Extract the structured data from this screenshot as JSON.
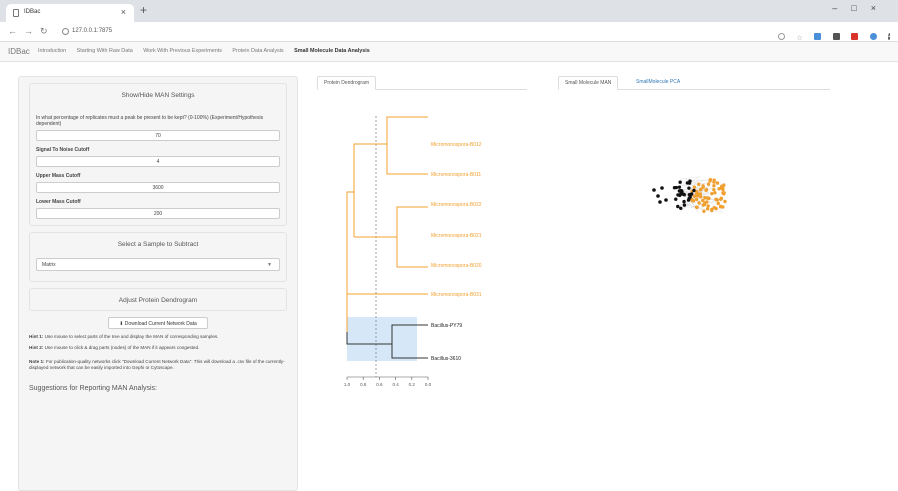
{
  "browser": {
    "tab_title": "IDBac",
    "url": "127.0.0.1:7875"
  },
  "app": {
    "brand": "IDBac",
    "nav": [
      {
        "label": "Introduction"
      },
      {
        "label": "Starting With Raw Data"
      },
      {
        "label": "Work With Previous Experiments"
      },
      {
        "label": "Protein Data Analysis"
      },
      {
        "label": "Small Molecule Data Analysis",
        "active": true
      }
    ]
  },
  "sidebar": {
    "man_settings": {
      "title": "Show/Hide MAN Settings",
      "pct_label": "In what percentage of replicates must a peak be present to be kept? (0-100%) (Experiment/Hypothesis dependent)",
      "pct_value": "70",
      "snr_label": "Signal To Noise Cutoff",
      "snr_value": "4",
      "upper_label": "Upper Mass Cutoff",
      "upper_value": "3600",
      "lower_label": "Lower Mass Cutoff",
      "lower_value": "200"
    },
    "subtract": {
      "title": "Select a Sample to Subtract",
      "selected": "Matrix"
    },
    "adjust": {
      "title": "Adjust Protein Dendrogram"
    },
    "download_label": "Download Current Network Data",
    "hint1_label": "Hint 1:",
    "hint1_text": "Use mouse to select parts of the tree and display the MAN of corresponding samples.",
    "hint2_label": "Hint 2:",
    "hint2_text": "Use mouse to click & drag parts (nodes) of the MAN if it appears congested.",
    "note1_label": "Note 1:",
    "note1_text": "For publication-quality networks click \"Download Current Network Data\". This will download a .csv file of the currently-displayed network that can be easily imported into Gephi or Cytoscape.",
    "suggestions_title": "Suggestions for Reporting MAN Analysis:"
  },
  "middle": {
    "tab": "Protein Dendrogram",
    "leaves": [
      {
        "label": "Micromonospora-B012",
        "color": "#f0a030"
      },
      {
        "label": "Micromonospora-B011",
        "color": "#f0a030"
      },
      {
        "label": "Micromonospora-B022",
        "color": "#f0a030"
      },
      {
        "label": "Micromonospora-B021",
        "color": "#f0a030"
      },
      {
        "label": "Micromonospora-B020",
        "color": "#f0a030"
      },
      {
        "label": "Micromonospora-B031",
        "color": "#f0a030"
      },
      {
        "label": "Bacillus-PY79",
        "color": "#222222"
      },
      {
        "label": "Bacillus-3610",
        "color": "#222222"
      }
    ],
    "axis_ticks": [
      "1.0",
      "0.8",
      "0.6",
      "0.4",
      "0.2",
      "0.0"
    ],
    "orange": "#f0a030",
    "dark": "#333333",
    "highlight": "#d6e8f8"
  },
  "right": {
    "tab1": "Small Molecule MAN",
    "tab2": "SmallMolecule PCA"
  }
}
